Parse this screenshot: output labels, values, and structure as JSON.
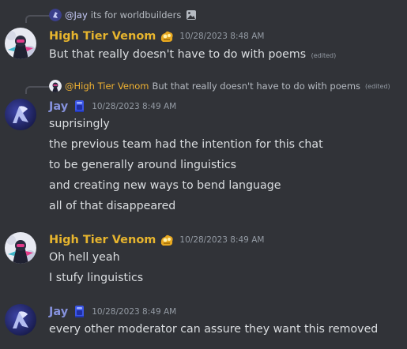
{
  "messages": [
    {
      "reply": {
        "mention": "@Jay",
        "text": "its for worldbuilders",
        "attachment_icon": "image-icon"
      },
      "author": "High Tier Venom",
      "badge_icon": "gold-badge-icon",
      "timestamp": "10/28/2023 8:48 AM",
      "lines": [
        {
          "text": "But that really doesn't have to do with poems",
          "edited": "(edited)"
        }
      ]
    },
    {
      "reply": {
        "mention": "@High Tier Venom",
        "text": "But that really doesn't have to do with poems",
        "edited": "(edited)"
      },
      "author": "Jay",
      "badge_icon": "book-badge-icon",
      "timestamp": "10/28/2023 8:49 AM",
      "lines": [
        {
          "text": "suprisingly"
        },
        {
          "text": "the previous team had the intention for this chat"
        },
        {
          "text": "to be generally around linguistics"
        },
        {
          "text": "and creating new ways to bend language"
        },
        {
          "text": "all of that disappeared"
        }
      ]
    },
    {
      "author": "High Tier Venom",
      "badge_icon": "gold-badge-icon",
      "timestamp": "10/28/2023 8:49 AM",
      "lines": [
        {
          "text": "Oh hell yeah"
        },
        {
          "text": "I stufy linguistics"
        }
      ]
    },
    {
      "author": "Jay",
      "badge_icon": "book-badge-icon",
      "timestamp": "10/28/2023 8:49 AM",
      "lines": [
        {
          "text": "every other moderator can assure they want this removed"
        }
      ]
    }
  ],
  "colors": {
    "background": "#313338",
    "venom_name": "#e7b52e",
    "jay_name": "#8692dd",
    "text": "#dbdee1",
    "muted": "#949ba4"
  }
}
